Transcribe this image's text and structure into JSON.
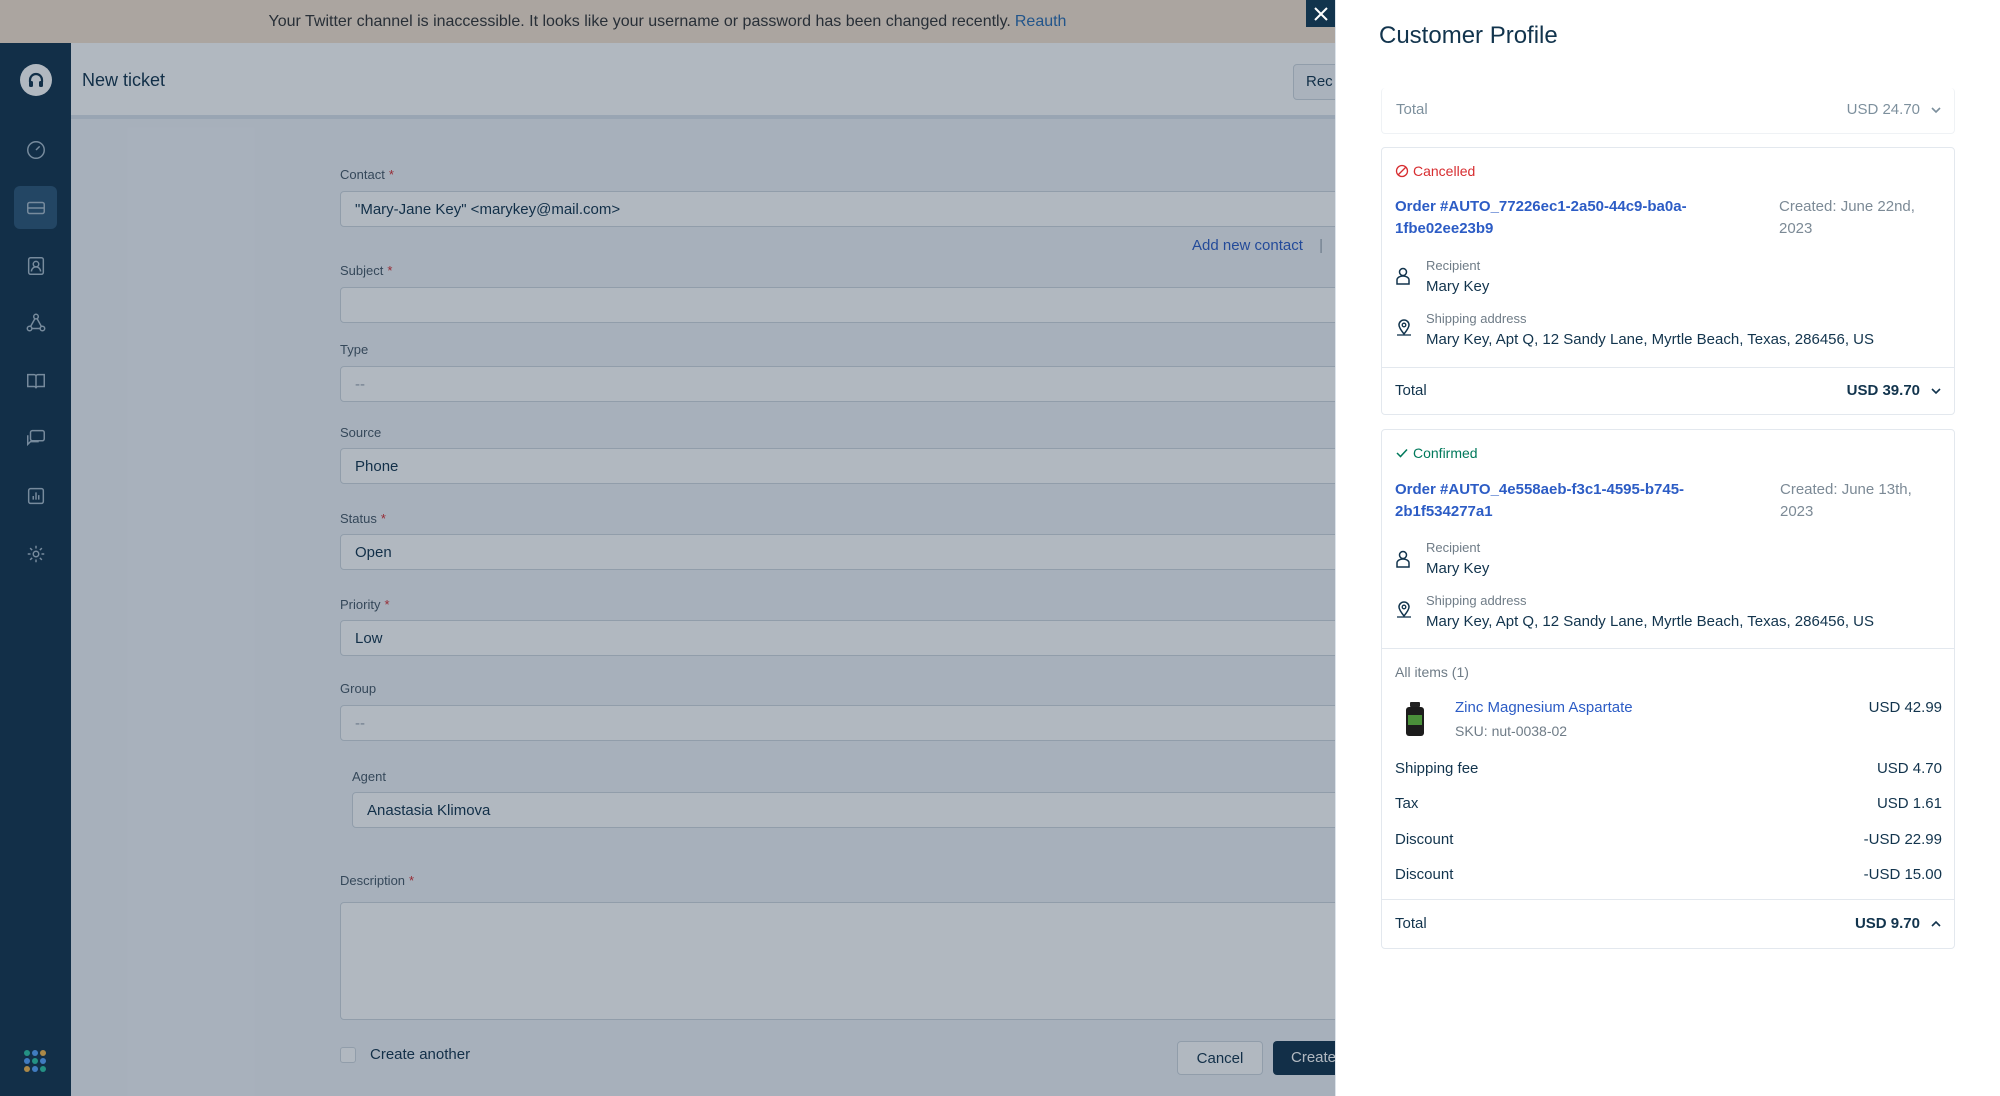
{
  "banner": {
    "message": "Your Twitter channel is inaccessible. It looks like your username or password has been changed recently.",
    "link": "Reauth"
  },
  "header": {
    "title": "New ticket",
    "button_label": "Rec"
  },
  "form": {
    "contact": {
      "label": "Contact",
      "value": "\"Mary-Jane Key\" <marykey@mail.com>"
    },
    "add_contact_link": "Add new contact",
    "add_contact_sep": "|",
    "subject": {
      "label": "Subject",
      "value": ""
    },
    "type": {
      "label": "Type",
      "value": "--"
    },
    "source": {
      "label": "Source",
      "value": "Phone"
    },
    "status": {
      "label": "Status",
      "value": "Open"
    },
    "priority": {
      "label": "Priority",
      "value": "Low"
    },
    "group": {
      "label": "Group",
      "value": "--"
    },
    "agent": {
      "label": "Agent",
      "value": "Anastasia Klimova"
    },
    "description": {
      "label": "Description",
      "value": ""
    },
    "required_mark": "*",
    "create_another": "Create another",
    "cancel": "Cancel",
    "create": "Create"
  },
  "panel": {
    "title": "Customer Profile",
    "top_total": {
      "label": "Total",
      "value": "USD 24.70"
    },
    "orders": [
      {
        "status": "Cancelled",
        "order_id": "Order #AUTO_77226ec1-2a50-44c9-ba0a-1fbe02ee23b9",
        "created": "Created: June 22nd, 2023",
        "recipient_label": "Recipient",
        "recipient": "Mary Key",
        "shipping_label": "Shipping address",
        "shipping": "Mary Key, Apt Q, 12 Sandy Lane, Myrtle Beach, Texas, 286456, US",
        "total_label": "Total",
        "total": "USD 39.70"
      },
      {
        "status": "Confirmed",
        "order_id": "Order #AUTO_4e558aeb-f3c1-4595-b745-2b1f534277a1",
        "created": "Created: June 13th, 2023",
        "recipient_label": "Recipient",
        "recipient": "Mary Key",
        "shipping_label": "Shipping address",
        "shipping": "Mary Key, Apt Q, 12 Sandy Lane, Myrtle Beach, Texas, 286456, US",
        "items_header": "All items (1)",
        "item": {
          "name": "Zinc Magnesium Aspartate",
          "sku": "SKU: nut-0038-02",
          "price": "USD 42.99"
        },
        "lines": [
          {
            "label": "Shipping fee",
            "value": "USD 4.70"
          },
          {
            "label": "Tax",
            "value": "USD 1.61"
          },
          {
            "label": "Discount",
            "value": "-USD 22.99"
          },
          {
            "label": "Discount",
            "value": "-USD 15.00"
          }
        ],
        "total_label": "Total",
        "total": "USD 9.70"
      }
    ]
  },
  "colors": {
    "navbar": "#12344d",
    "accent_link": "#2c5cc5",
    "cancelled": "#d72d30",
    "confirmed": "#00795b"
  },
  "icons": [
    "headset-logo-icon",
    "dashboard-icon",
    "tickets-icon",
    "contacts-icon",
    "groups-icon",
    "solutions-icon",
    "forums-icon",
    "reports-icon",
    "settings-icon",
    "apps-grid-icon",
    "close-icon",
    "cancelled-icon",
    "check-icon",
    "person-icon",
    "location-icon",
    "chevron-down-icon",
    "chevron-up-icon",
    "product-bottle-icon"
  ]
}
